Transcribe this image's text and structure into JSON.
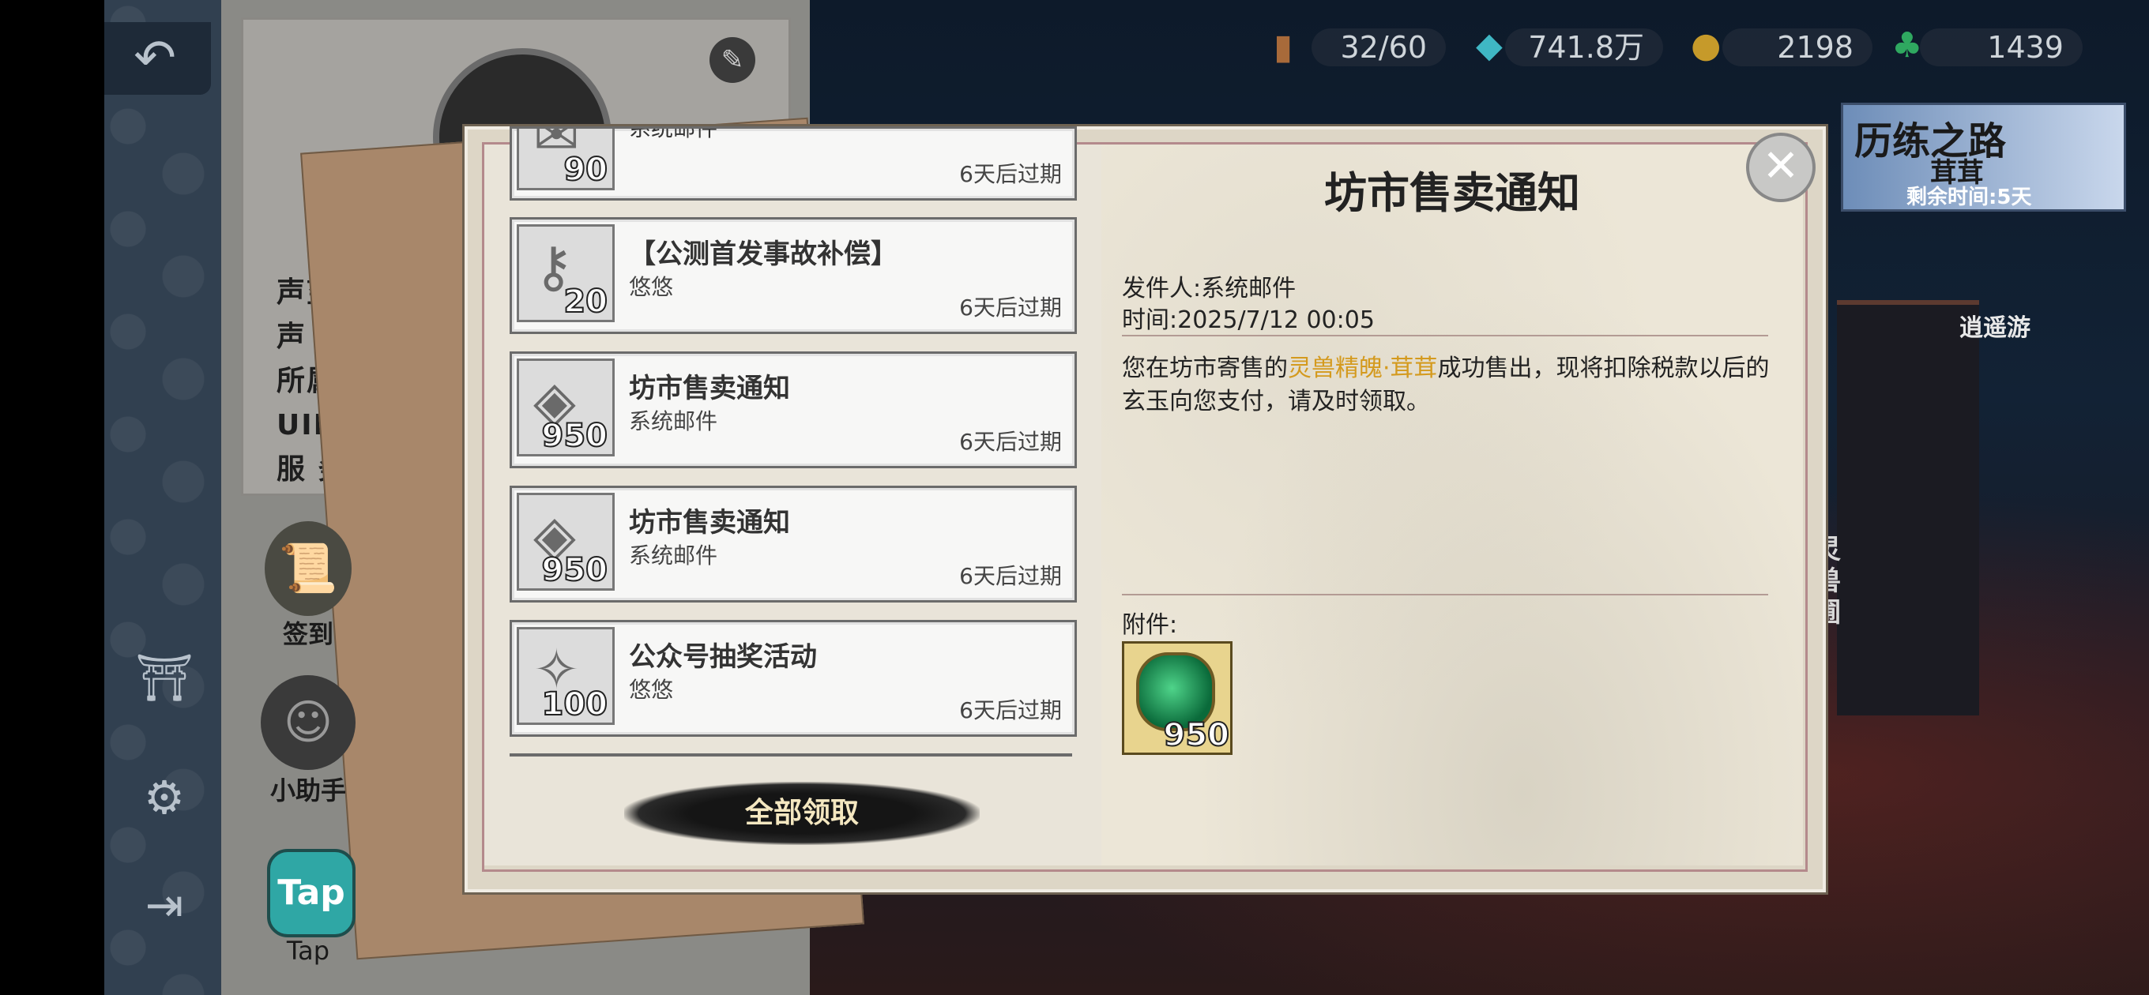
{
  "topbar": {
    "resources": [
      {
        "icon": "wooden-plaque-icon",
        "value": "32/60"
      },
      {
        "icon": "crystal-icon",
        "value": "741.8万"
      },
      {
        "icon": "gold-ingot-icon",
        "value": "2198"
      },
      {
        "icon": "jade-icon",
        "value": "1439"
      }
    ]
  },
  "event_banner": {
    "title": "历练之路",
    "subtitle": "茸茸",
    "remaining": "剩余时间:5天"
  },
  "scene": {
    "wander_label": "逍遥游",
    "beast_label": "灵兽圃"
  },
  "left_nav": {
    "icons": [
      "back-arrow-icon",
      "gate-icon",
      "gear-icon",
      "logout-icon"
    ]
  },
  "profile": {
    "labels": [
      "声望等",
      "声 望",
      "所属仙盟",
      "UID账号",
      "服 务 器"
    ],
    "side_buttons": [
      {
        "label": "签到",
        "icon": "scroll-brush-icon"
      },
      {
        "label": "小助手",
        "icon": "helper-girl-icon"
      },
      {
        "label": "Tap",
        "icon": "tap-logo-icon"
      }
    ]
  },
  "mail_list": [
    {
      "title": "系统邮件",
      "sender": "",
      "qty": "90",
      "expire": "6天后过期",
      "icon": "scroll-icon"
    },
    {
      "title": "【公测首发事故补偿】",
      "sender": "悠悠",
      "qty": "20",
      "expire": "6天后过期",
      "icon": "key-icon"
    },
    {
      "title": "坊市售卖通知",
      "sender": "系统邮件",
      "qty": "950",
      "expire": "6天后过期",
      "icon": "jade-stone-icon"
    },
    {
      "title": "坊市售卖通知",
      "sender": "系统邮件",
      "qty": "950",
      "expire": "6天后过期",
      "icon": "jade-stone-icon"
    },
    {
      "title": "公众号抽奖活动",
      "sender": "悠悠",
      "qty": "100",
      "expire": "6天后过期",
      "icon": "crystal-shard-icon"
    }
  ],
  "claim_all_label": "全部领取",
  "detail": {
    "title": "坊市售卖通知",
    "sender_label": "发件人:",
    "sender": "系统邮件",
    "time_label": "时间:",
    "time": "2025/7/12 00:05",
    "body_before": "您在坊市寄售的",
    "body_highlight": "灵兽精魄·茸茸",
    "body_after": "成功售出，现将扣除税款以后的玄玉向您支付，请及时领取。",
    "attachment_label": "附件:",
    "attachment_qty": "950",
    "attachment_icon": "green-jade-icon"
  },
  "colors": {
    "highlight": "#d49a1e",
    "dialog_bg": "#ddd6c6",
    "attachment_bg": "#e8d48e"
  }
}
